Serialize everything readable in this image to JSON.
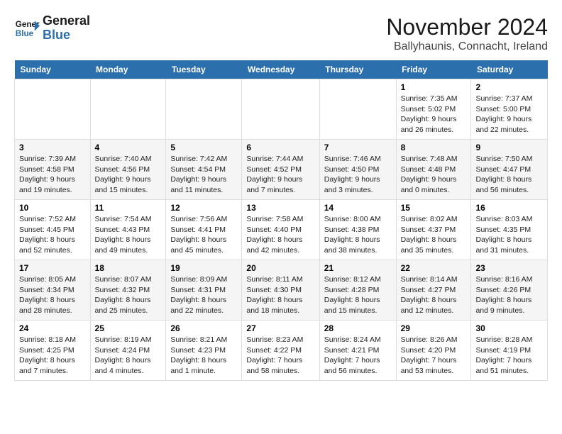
{
  "logo": {
    "line1": "General",
    "line2": "Blue"
  },
  "header": {
    "month": "November 2024",
    "location": "Ballyhaunis, Connacht, Ireland"
  },
  "weekdays": [
    "Sunday",
    "Monday",
    "Tuesday",
    "Wednesday",
    "Thursday",
    "Friday",
    "Saturday"
  ],
  "weeks": [
    [
      null,
      null,
      null,
      null,
      null,
      {
        "day": "1",
        "sunrise": "Sunrise: 7:35 AM",
        "sunset": "Sunset: 5:02 PM",
        "daylight": "Daylight: 9 hours and 26 minutes."
      },
      {
        "day": "2",
        "sunrise": "Sunrise: 7:37 AM",
        "sunset": "Sunset: 5:00 PM",
        "daylight": "Daylight: 9 hours and 22 minutes."
      }
    ],
    [
      {
        "day": "3",
        "sunrise": "Sunrise: 7:39 AM",
        "sunset": "Sunset: 4:58 PM",
        "daylight": "Daylight: 9 hours and 19 minutes."
      },
      {
        "day": "4",
        "sunrise": "Sunrise: 7:40 AM",
        "sunset": "Sunset: 4:56 PM",
        "daylight": "Daylight: 9 hours and 15 minutes."
      },
      {
        "day": "5",
        "sunrise": "Sunrise: 7:42 AM",
        "sunset": "Sunset: 4:54 PM",
        "daylight": "Daylight: 9 hours and 11 minutes."
      },
      {
        "day": "6",
        "sunrise": "Sunrise: 7:44 AM",
        "sunset": "Sunset: 4:52 PM",
        "daylight": "Daylight: 9 hours and 7 minutes."
      },
      {
        "day": "7",
        "sunrise": "Sunrise: 7:46 AM",
        "sunset": "Sunset: 4:50 PM",
        "daylight": "Daylight: 9 hours and 3 minutes."
      },
      {
        "day": "8",
        "sunrise": "Sunrise: 7:48 AM",
        "sunset": "Sunset: 4:48 PM",
        "daylight": "Daylight: 9 hours and 0 minutes."
      },
      {
        "day": "9",
        "sunrise": "Sunrise: 7:50 AM",
        "sunset": "Sunset: 4:47 PM",
        "daylight": "Daylight: 8 hours and 56 minutes."
      }
    ],
    [
      {
        "day": "10",
        "sunrise": "Sunrise: 7:52 AM",
        "sunset": "Sunset: 4:45 PM",
        "daylight": "Daylight: 8 hours and 52 minutes."
      },
      {
        "day": "11",
        "sunrise": "Sunrise: 7:54 AM",
        "sunset": "Sunset: 4:43 PM",
        "daylight": "Daylight: 8 hours and 49 minutes."
      },
      {
        "day": "12",
        "sunrise": "Sunrise: 7:56 AM",
        "sunset": "Sunset: 4:41 PM",
        "daylight": "Daylight: 8 hours and 45 minutes."
      },
      {
        "day": "13",
        "sunrise": "Sunrise: 7:58 AM",
        "sunset": "Sunset: 4:40 PM",
        "daylight": "Daylight: 8 hours and 42 minutes."
      },
      {
        "day": "14",
        "sunrise": "Sunrise: 8:00 AM",
        "sunset": "Sunset: 4:38 PM",
        "daylight": "Daylight: 8 hours and 38 minutes."
      },
      {
        "day": "15",
        "sunrise": "Sunrise: 8:02 AM",
        "sunset": "Sunset: 4:37 PM",
        "daylight": "Daylight: 8 hours and 35 minutes."
      },
      {
        "day": "16",
        "sunrise": "Sunrise: 8:03 AM",
        "sunset": "Sunset: 4:35 PM",
        "daylight": "Daylight: 8 hours and 31 minutes."
      }
    ],
    [
      {
        "day": "17",
        "sunrise": "Sunrise: 8:05 AM",
        "sunset": "Sunset: 4:34 PM",
        "daylight": "Daylight: 8 hours and 28 minutes."
      },
      {
        "day": "18",
        "sunrise": "Sunrise: 8:07 AM",
        "sunset": "Sunset: 4:32 PM",
        "daylight": "Daylight: 8 hours and 25 minutes."
      },
      {
        "day": "19",
        "sunrise": "Sunrise: 8:09 AM",
        "sunset": "Sunset: 4:31 PM",
        "daylight": "Daylight: 8 hours and 22 minutes."
      },
      {
        "day": "20",
        "sunrise": "Sunrise: 8:11 AM",
        "sunset": "Sunset: 4:30 PM",
        "daylight": "Daylight: 8 hours and 18 minutes."
      },
      {
        "day": "21",
        "sunrise": "Sunrise: 8:12 AM",
        "sunset": "Sunset: 4:28 PM",
        "daylight": "Daylight: 8 hours and 15 minutes."
      },
      {
        "day": "22",
        "sunrise": "Sunrise: 8:14 AM",
        "sunset": "Sunset: 4:27 PM",
        "daylight": "Daylight: 8 hours and 12 minutes."
      },
      {
        "day": "23",
        "sunrise": "Sunrise: 8:16 AM",
        "sunset": "Sunset: 4:26 PM",
        "daylight": "Daylight: 8 hours and 9 minutes."
      }
    ],
    [
      {
        "day": "24",
        "sunrise": "Sunrise: 8:18 AM",
        "sunset": "Sunset: 4:25 PM",
        "daylight": "Daylight: 8 hours and 7 minutes."
      },
      {
        "day": "25",
        "sunrise": "Sunrise: 8:19 AM",
        "sunset": "Sunset: 4:24 PM",
        "daylight": "Daylight: 8 hours and 4 minutes."
      },
      {
        "day": "26",
        "sunrise": "Sunrise: 8:21 AM",
        "sunset": "Sunset: 4:23 PM",
        "daylight": "Daylight: 8 hours and 1 minute."
      },
      {
        "day": "27",
        "sunrise": "Sunrise: 8:23 AM",
        "sunset": "Sunset: 4:22 PM",
        "daylight": "Daylight: 7 hours and 58 minutes."
      },
      {
        "day": "28",
        "sunrise": "Sunrise: 8:24 AM",
        "sunset": "Sunset: 4:21 PM",
        "daylight": "Daylight: 7 hours and 56 minutes."
      },
      {
        "day": "29",
        "sunrise": "Sunrise: 8:26 AM",
        "sunset": "Sunset: 4:20 PM",
        "daylight": "Daylight: 7 hours and 53 minutes."
      },
      {
        "day": "30",
        "sunrise": "Sunrise: 8:28 AM",
        "sunset": "Sunset: 4:19 PM",
        "daylight": "Daylight: 7 hours and 51 minutes."
      }
    ]
  ]
}
